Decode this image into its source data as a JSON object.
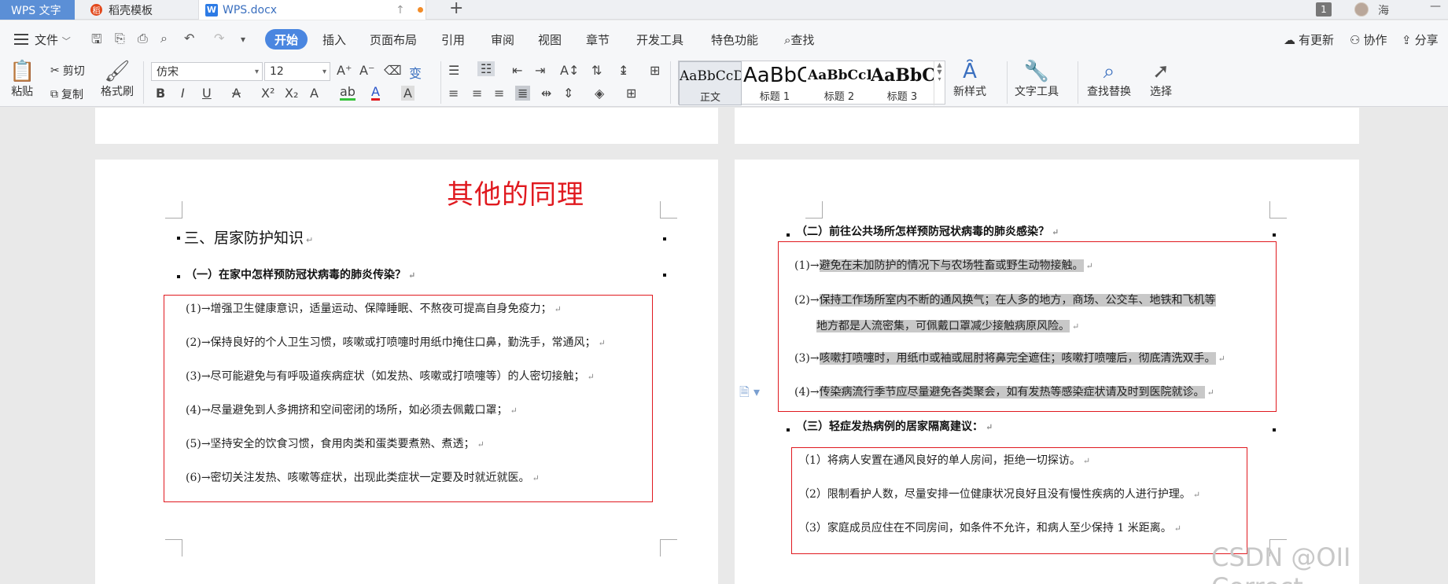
{
  "titlebar": {
    "app_tab": "WPS 文字",
    "template_tab": "稻壳模板",
    "doc_tab": "WPS.docx",
    "doc_icon": "W",
    "template_icon": "稻",
    "new_tab": "+",
    "badge": "1",
    "user": "海",
    "minimize": "—"
  },
  "menubar": {
    "file": "文件",
    "tabs": [
      "开始",
      "插入",
      "页面布局",
      "引用",
      "审阅",
      "视图",
      "章节",
      "开发工具",
      "特色功能"
    ],
    "search": "查找",
    "right": [
      "有更新",
      "协作",
      "分享"
    ]
  },
  "ribbon": {
    "paste": "粘贴",
    "cut": "剪切",
    "copy": "复制",
    "format_painter": "格式刷",
    "font_name": "仿宋",
    "font_size": "12",
    "styles": [
      {
        "preview": "AaBbCcDd",
        "label": "正文"
      },
      {
        "preview": "AaBbC",
        "label": "标题 1"
      },
      {
        "preview": "AaBbCcDd",
        "label": "标题 2"
      },
      {
        "preview": "AaBbCc",
        "label": "标题 3"
      }
    ],
    "new_style": "新样式",
    "text_tools": "文字工具",
    "find_replace": "查找替换",
    "select": "选择"
  },
  "doc": {
    "annotation": "其他的同理",
    "section_title": "三、居家防护知识",
    "left_sub": "（一）在家中怎样预防冠状病毒的肺炎传染？",
    "left_items": [
      "(1)→增强卫生健康意识，适量运动、保障睡眠、不熬夜可提高自身免疫力；",
      "(2)→保持良好的个人卫生习惯，咳嗽或打喷嚏时用纸巾掩住口鼻，勤洗手，常通风；",
      "(3)→尽可能避免与有呼吸道疾病症状（如发热、咳嗽或打喷嚏等）的人密切接触；",
      "(4)→尽量避免到人多拥挤和空间密闭的场所，如必须去佩戴口罩；",
      "(5)→坚持安全的饮食习惯，食用肉类和蛋类要煮熟、煮透；",
      "(6)→密切关注发热、咳嗽等症状，出现此类症状一定要及时就近就医。"
    ],
    "right_sub1": "（二）前往公共场所怎样预防冠状病毒的肺炎感染？",
    "right_items1": [
      {
        "num": "(1)→",
        "text": "避免在未加防护的情况下与农场牲畜或野生动物接触。"
      },
      {
        "num": "(2)→",
        "text": "保持工作场所室内不断的通风换气；在人多的地方，商场、公交车、地铁和飞机等"
      },
      {
        "num": "",
        "text": "地方都是人流密集，可佩戴口罩减少接触病原风险。"
      },
      {
        "num": "(3)→",
        "text": "咳嗽打喷嚏时，用纸巾或袖或屈肘将鼻完全遮住；咳嗽打喷嚏后，彻底清洗双手。"
      },
      {
        "num": "(4)→",
        "text": "传染病流行季节应尽量避免各类聚会，如有发热等感染症状请及时到医院就诊。"
      }
    ],
    "right_sub2": "（三）轻症发热病例的居家隔离建议：",
    "right_items2": [
      "（1）将病人安置在通风良好的单人房间，拒绝一切探访。",
      "（2）限制看护人数，尽量安排一位健康状况良好且没有慢性疾病的人进行护理。",
      "（3）家庭成员应住在不同房间，如条件不允许，和病人至少保持 1 米距离。"
    ],
    "return_mark": "↵",
    "watermark": "CSDN @OII Correct"
  }
}
